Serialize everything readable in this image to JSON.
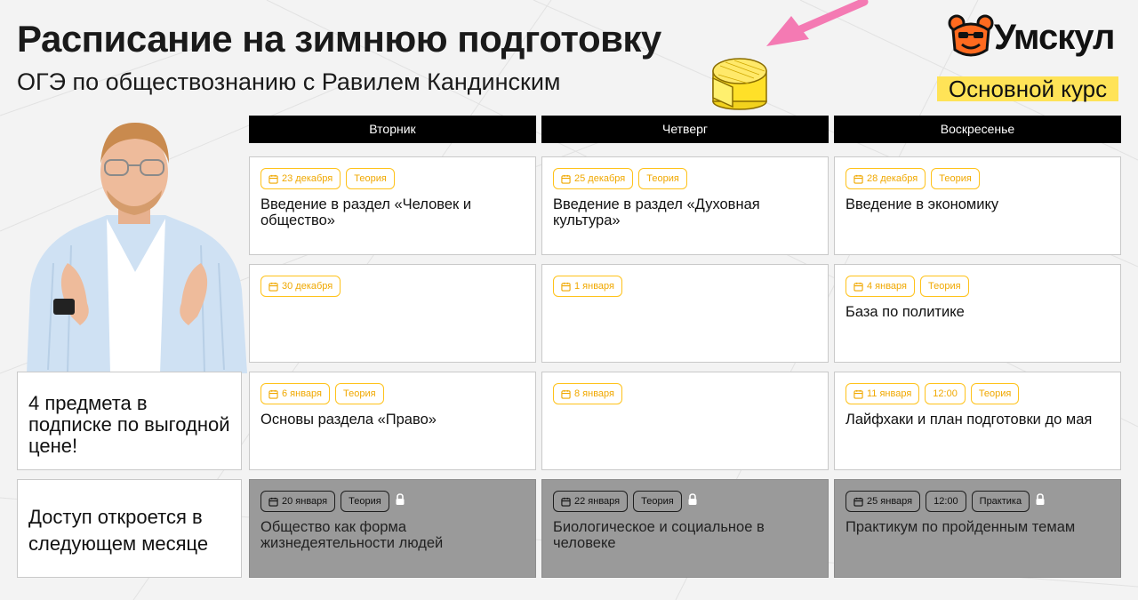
{
  "header": {
    "title": "Расписание на зимнюю подготовку",
    "subtitle": "ОГЭ по обществознанию с Равилем Кандинским"
  },
  "brand": {
    "logo_text": "Умскул",
    "course_badge": "Основной курс",
    "accent_color": "#ffe357",
    "tag_color": "#ffc21a"
  },
  "days": [
    "Вторник",
    "Четверг",
    "Воскресенье"
  ],
  "side_cards": [
    {
      "text": "4 предмета в подписке по выгодной цене!"
    },
    {
      "text": "Доступ откроется в следующем месяце"
    }
  ],
  "schedule": [
    [
      {
        "date": "23 декабря",
        "tags": [
          "Теория"
        ],
        "title": "Введение в раздел «Человек и общество»",
        "locked": false
      },
      {
        "date": "25 декабря",
        "tags": [
          "Теория"
        ],
        "title": "Введение в раздел «Духовная культура»",
        "locked": false
      },
      {
        "date": "28 декабря",
        "tags": [
          "Теория"
        ],
        "title": "Введение в экономику",
        "locked": false
      }
    ],
    [
      {
        "date": "30 декабря",
        "tags": [],
        "title": "",
        "locked": false
      },
      {
        "date": "1 января",
        "tags": [],
        "title": "",
        "locked": false
      },
      {
        "date": "4 января",
        "tags": [
          "Теория"
        ],
        "title": "База по политике",
        "locked": false
      }
    ],
    [
      {
        "date": "6 января",
        "tags": [
          "Теория"
        ],
        "title": "Основы раздела «Право»",
        "locked": false
      },
      {
        "date": "8 января",
        "tags": [],
        "title": "",
        "locked": false
      },
      {
        "date": "11 января",
        "tags": [
          "12:00",
          "Теория"
        ],
        "title": "Лайфхаки и план подготовки до мая",
        "locked": false
      }
    ],
    [
      {
        "date": "20 января",
        "tags": [
          "Теория"
        ],
        "title": "Общество как форма жизнедеятельности людей",
        "locked": true
      },
      {
        "date": "22 января",
        "tags": [
          "Теория"
        ],
        "title": "Биологическое и социальное в человеке",
        "locked": true
      },
      {
        "date": "25 января",
        "tags": [
          "12:00",
          "Практика"
        ],
        "title": "Практикум по пройденным темам",
        "locked": true
      }
    ]
  ]
}
